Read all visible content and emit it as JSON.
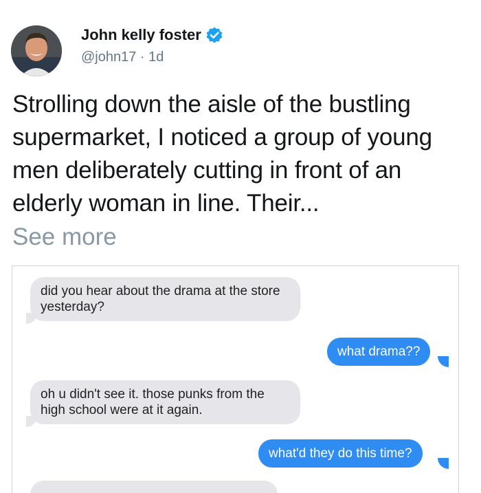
{
  "author": {
    "name": "John kelly foster",
    "handle": "@john17",
    "separator": " · ",
    "time": "1d",
    "verified": true
  },
  "tweet": {
    "text": "Strolling down the aisle of the bustling supermarket, I noticed a group of young men deliberately cutting in front of an elderly woman in line. Their...",
    "see_more_label": "See more"
  },
  "messages": [
    {
      "sender": "them",
      "text": "did you hear about the drama at the store yesterday?"
    },
    {
      "sender": "me",
      "text": "what drama??"
    },
    {
      "sender": "them",
      "text": "oh u didn't see it. those punks from the high school were at it again."
    },
    {
      "sender": "me",
      "text": "what'd they do this time?"
    }
  ],
  "colors": {
    "incoming_bubble": "#e5e5ea",
    "outgoing_bubble": "#2f8cf2",
    "verified_badge": "#1da1f2",
    "muted_text": "#657786"
  },
  "icons": {
    "verified": "verified-badge-icon"
  }
}
